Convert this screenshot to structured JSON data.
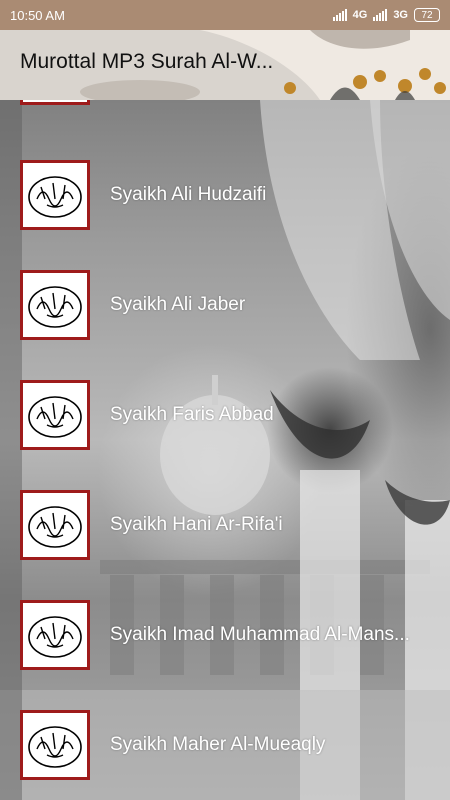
{
  "status_bar": {
    "time": "10:50 AM",
    "network_1": "4G",
    "network_2": "3G",
    "battery": "72"
  },
  "app_bar": {
    "title": "Murottal MP3 Surah Al-W..."
  },
  "list": {
    "items": [
      {
        "label": ""
      },
      {
        "label": "Syaikh Ali Hudzaifi"
      },
      {
        "label": "Syaikh Ali Jaber"
      },
      {
        "label": "Syaikh Faris Abbad"
      },
      {
        "label": "Syaikh Hani Ar-Rifa'i"
      },
      {
        "label": "Syaikh Imad Muhammad Al-Mans..."
      },
      {
        "label": "Syaikh Maher Al-Mueaqly"
      }
    ]
  },
  "colors": {
    "status_bar": "#aa8b73",
    "thumb_border": "#9e1b1b",
    "label_text": "#ffffff"
  },
  "icons": {
    "thumbnail": "bismillah-calligraphy-icon"
  }
}
